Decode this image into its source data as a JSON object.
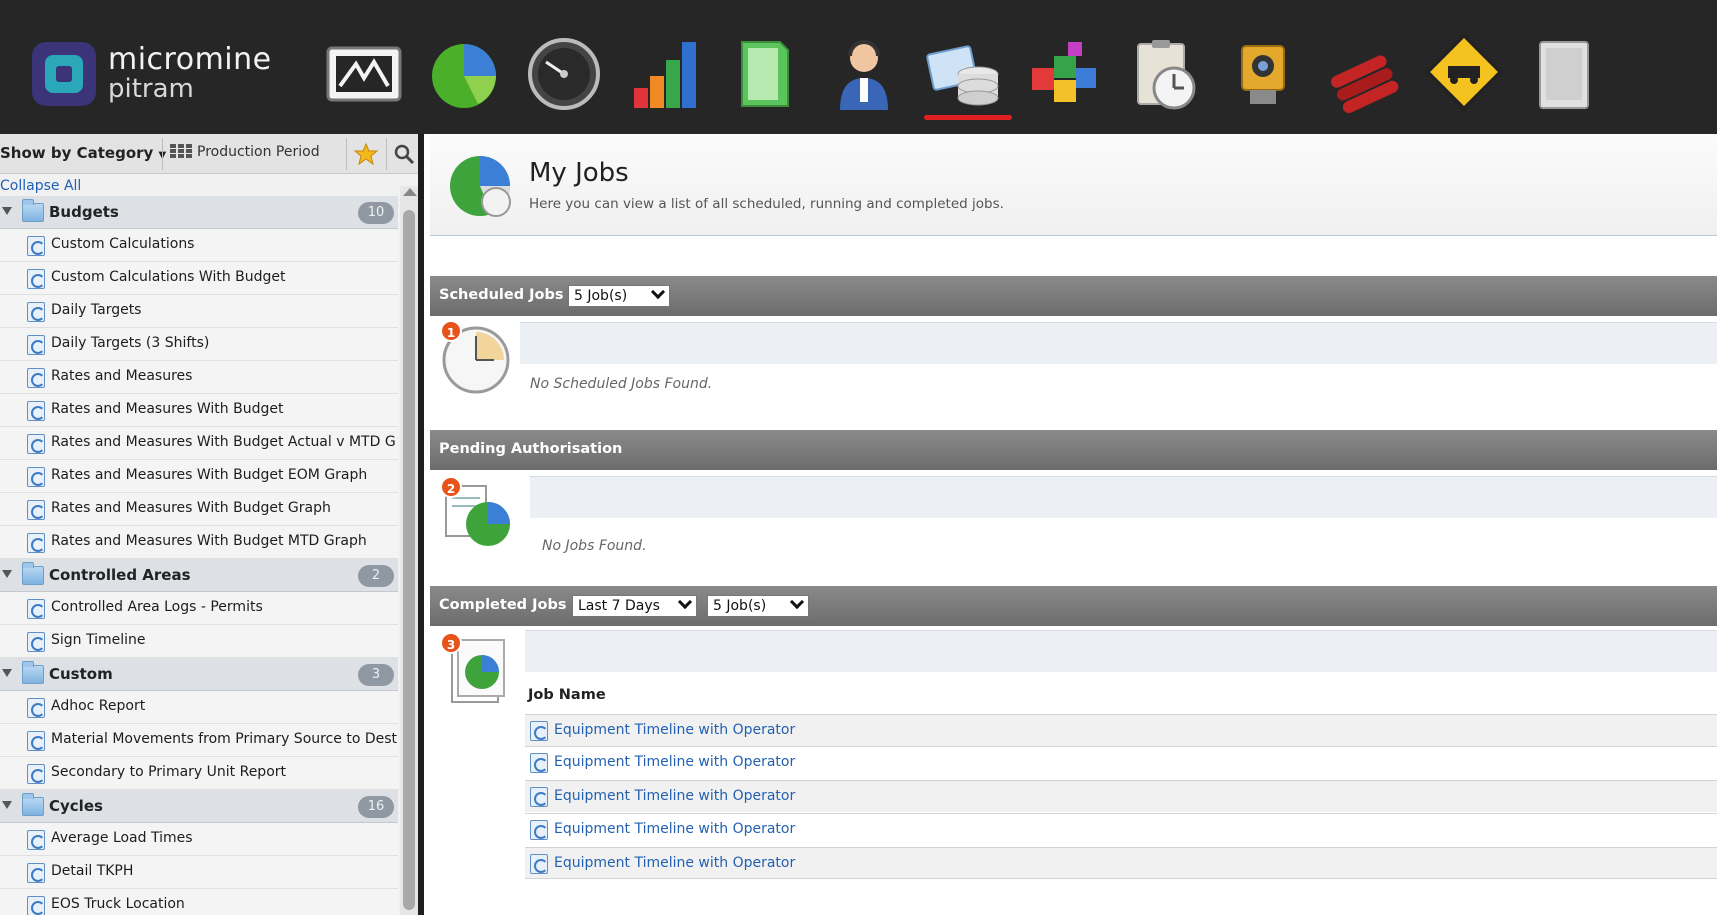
{
  "brand": {
    "line1": "micromine",
    "line2": "pitram"
  },
  "nav": {
    "icons": [
      {
        "name": "dashboard-monitor-icon"
      },
      {
        "name": "pie-chart-icon"
      },
      {
        "name": "speedometer-icon"
      },
      {
        "name": "bar-chart-icon"
      },
      {
        "name": "document-icon"
      },
      {
        "name": "operator-headset-icon"
      },
      {
        "name": "jobs-database-icon",
        "active": true
      },
      {
        "name": "blocks-icon"
      },
      {
        "name": "clipboard-clock-icon"
      },
      {
        "name": "surveyor-camera-icon"
      },
      {
        "name": "explosives-icon"
      },
      {
        "name": "truck-warning-sign-icon"
      },
      {
        "name": "server-tower-icon"
      }
    ],
    "active_color": "#e02020"
  },
  "sidebar": {
    "show_by": "Show by Category",
    "production_period": "Production Period",
    "collapse_all": "Collapse All",
    "categories": [
      {
        "label": "Budgets",
        "count": "10",
        "items": [
          "Custom Calculations",
          "Custom Calculations With Budget",
          "Daily Targets",
          "Daily Targets (3 Shifts)",
          "Rates and Measures",
          "Rates and Measures With Budget",
          "Rates and Measures With Budget Actual v MTD G",
          "Rates and Measures With Budget EOM Graph",
          "Rates and Measures With Budget Graph",
          "Rates and Measures With Budget MTD Graph"
        ]
      },
      {
        "label": "Controlled Areas",
        "count": "2",
        "items": [
          "Controlled Area Logs - Permits",
          "Sign Timeline"
        ]
      },
      {
        "label": "Custom",
        "count": "3",
        "items": [
          "Adhoc Report",
          "Material Movements from Primary Source to Desti",
          "Secondary to Primary Unit Report"
        ]
      },
      {
        "label": "Cycles",
        "count": "16",
        "items": [
          "Average Load Times",
          "Detail TKPH",
          "EOS Truck Location"
        ]
      }
    ]
  },
  "page": {
    "title": "My Jobs",
    "subtitle": "Here you can view a list of all scheduled, running and completed jobs."
  },
  "scheduled": {
    "title": "Scheduled Jobs",
    "count_select": "5 Job(s)",
    "badge": "1",
    "empty": "No Scheduled Jobs Found."
  },
  "pending": {
    "title": "Pending Authorisation",
    "badge": "2",
    "empty": "No Jobs Found."
  },
  "completed": {
    "title": "Completed Jobs",
    "range_select": "Last 7 Days",
    "count_select": "5 Job(s)",
    "badge": "3",
    "column_header": "Job Name",
    "jobs": [
      "Equipment Timeline with Operator",
      "Equipment Timeline with Operator",
      "Equipment Timeline with Operator",
      "Equipment Timeline with Operator",
      "Equipment Timeline with Operator"
    ]
  }
}
